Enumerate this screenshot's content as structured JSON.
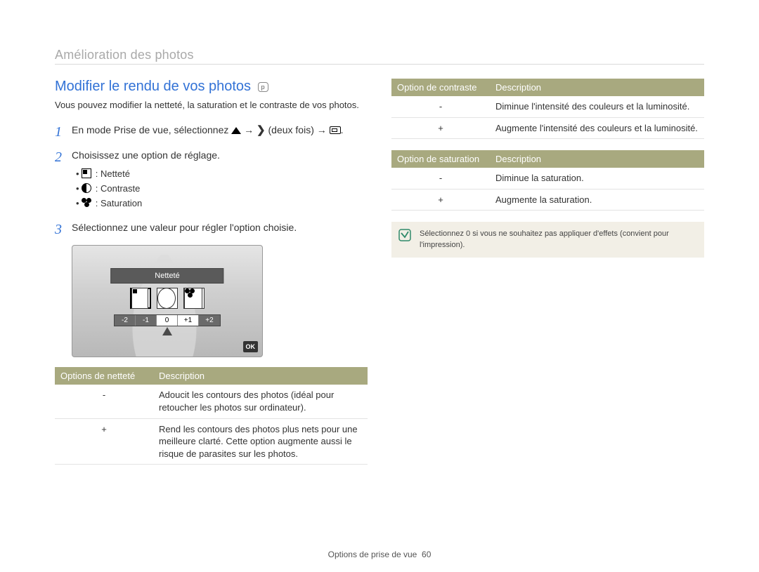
{
  "chapter": "Amélioration des photos",
  "section_title": "Modifier le rendu de vos photos",
  "mode_chip": "p",
  "intro": "Vous pouvez modifier la netteté, la saturation et le contraste de vos photos.",
  "steps": {
    "s1_pre": "En mode Prise de vue, sélectionnez ",
    "s1_mid": " → ",
    "s1_post": " (deux fois) → ",
    "s2": "Choisissez une option de réglage.",
    "s2_b1": " : Netteté",
    "s2_b2": " : Contraste",
    "s2_b3": " : Saturation",
    "s3": "Sélectionnez une valeur pour régler l'option choisie."
  },
  "lcd": {
    "title": "Netteté",
    "scale": [
      "-2",
      "-1",
      "0",
      "+1",
      "+2"
    ],
    "ok": "OK"
  },
  "tables": {
    "sharp": {
      "h1": "Options de netteté",
      "h2": "Description",
      "r1s": "-",
      "r1d": "Adoucit les contours des photos (idéal pour retoucher les photos sur ordinateur).",
      "r2s": "+",
      "r2d": "Rend les contours des photos plus nets pour une meilleure clarté. Cette option augmente aussi le risque de parasites sur les photos."
    },
    "contrast": {
      "h1": "Option de contraste",
      "h2": "Description",
      "r1s": "-",
      "r1d": "Diminue l'intensité des couleurs et la luminosité.",
      "r2s": "+",
      "r2d": "Augmente l'intensité des couleurs et la luminosité."
    },
    "sat": {
      "h1": "Option de saturation",
      "h2": "Description",
      "r1s": "-",
      "r1d": "Diminue la saturation.",
      "r2s": "+",
      "r2d": "Augmente la saturation."
    }
  },
  "note": "Sélectionnez 0 si vous ne souhaitez pas appliquer d'effets (convient pour l'impression).",
  "footer_label": "Options de prise de vue",
  "footer_page": "60"
}
